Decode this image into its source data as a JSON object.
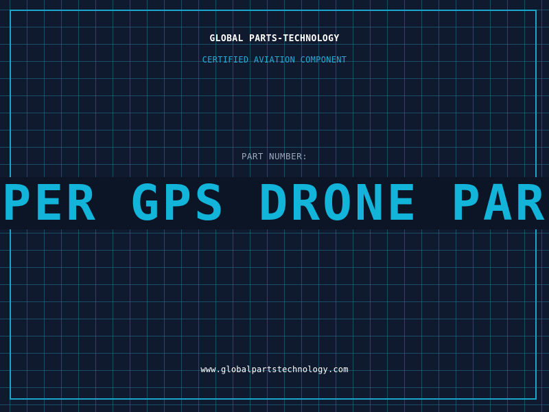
{
  "brand": {
    "name": "GLOBAL PARTS-TECHNOLOGY",
    "tagline": "CERTIFIED AVIATION COMPONENT"
  },
  "part": {
    "label": "PART NUMBER:",
    "value": "VIPER GPS DRONE PARTS"
  },
  "footer": {
    "website": "www.globalpartstechnology.com"
  },
  "colors": {
    "background": "#0f1a2e",
    "grid": "#26768f",
    "frame": "#1aa5cc",
    "accent": "#12b4d9",
    "label": "#9aa8bd",
    "text": "#ffffff"
  }
}
